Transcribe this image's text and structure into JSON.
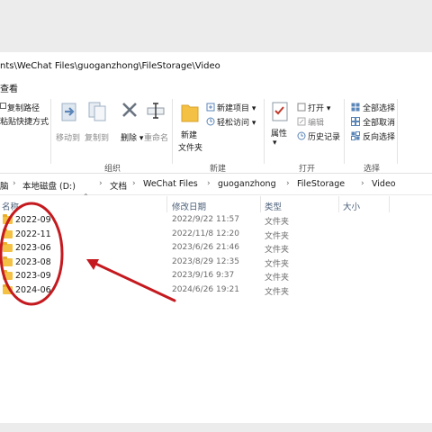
{
  "window": {
    "title_path": "nts\\WeChat Files\\guoganzhong\\FileStorage\\Video",
    "menu_view": "查看"
  },
  "ribbon": {
    "clipboard": {
      "copy_path": "复制路径",
      "paste_shortcut": "粘贴快捷方式"
    },
    "organize": {
      "move_to": "移动到",
      "copy_to": "复制到",
      "delete": "删除",
      "rename": "重命名",
      "label": "组织"
    },
    "new": {
      "new_folder_line1": "新建",
      "new_folder_line2": "文件夹",
      "new_item": "新建项目",
      "easy_access": "轻松访问",
      "label": "新建"
    },
    "open": {
      "properties": "属性",
      "open": "打开",
      "edit": "编辑",
      "history": "历史记录",
      "label": "打开"
    },
    "select": {
      "select_all": "全部选择",
      "select_none": "全部取消",
      "invert": "反向选择",
      "label": "选择"
    }
  },
  "breadcrumb": [
    "脑",
    "本地磁盘 (D:)",
    "文档",
    "WeChat Files",
    "guoganzhong",
    "FileStorage",
    "Video"
  ],
  "columns": {
    "name": "名称",
    "date": "修改日期",
    "type": "类型",
    "size": "大小"
  },
  "files": [
    {
      "name": "2022-09",
      "date": "2022/9/22 11:57",
      "type": "文件夹"
    },
    {
      "name": "2022-11",
      "date": "2022/11/8 12:20",
      "type": "文件夹"
    },
    {
      "name": "2023-06",
      "date": "2023/6/26 21:46",
      "type": "文件夹"
    },
    {
      "name": "2023-08",
      "date": "2023/8/29 12:35",
      "type": "文件夹"
    },
    {
      "name": "2023-09",
      "date": "2023/9/16 9:37",
      "type": "文件夹"
    },
    {
      "name": "2024-06",
      "date": "2024/6/26 19:21",
      "type": "文件夹"
    }
  ],
  "colors": {
    "annotation_red": "#c41a1f",
    "folder_yellow": "#f4c144",
    "header_text": "#4c607a"
  },
  "icons": {
    "move_to": "move-arrow-icon",
    "copy_to": "copy-icon",
    "delete": "x-icon",
    "rename": "rename-cursor-icon",
    "new_folder": "folder-icon",
    "properties": "checklist-icon",
    "history": "clock-icon",
    "select_all": "grid-icon"
  }
}
